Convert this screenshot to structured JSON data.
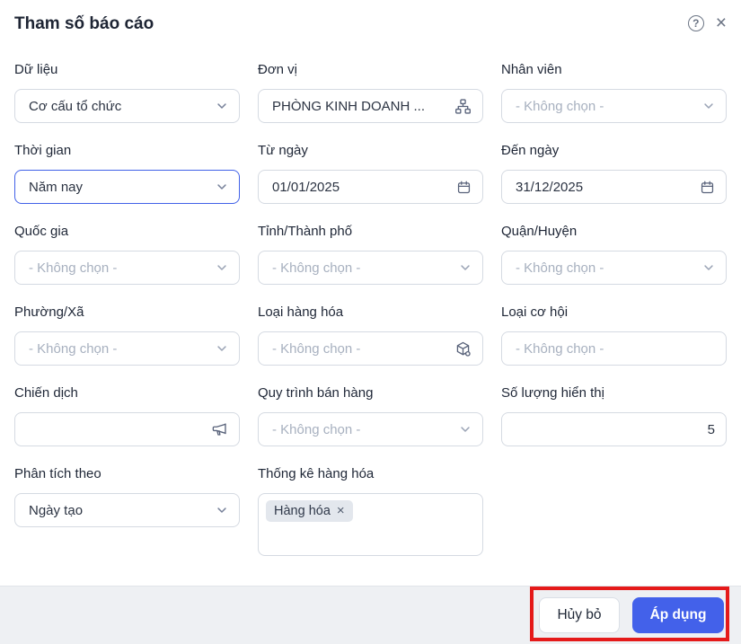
{
  "dialog": {
    "title": "Tham số báo cáo"
  },
  "fields": {
    "du_lieu": {
      "label": "Dữ liệu",
      "value": "Cơ cấu tổ chức"
    },
    "don_vi": {
      "label": "Đơn vị",
      "value": "PHÒNG KINH DOANH ...",
      "icon": "org-sitemap-icon"
    },
    "nhan_vien": {
      "label": "Nhân viên",
      "placeholder": "- Không chọn -"
    },
    "thoi_gian": {
      "label": "Thời gian",
      "value": "Năm nay",
      "state": "focused"
    },
    "tu_ngay": {
      "label": "Từ ngày",
      "value": "01/01/2025",
      "icon": "calendar-icon"
    },
    "den_ngay": {
      "label": "Đến ngày",
      "value": "31/12/2025",
      "icon": "calendar-icon"
    },
    "quoc_gia": {
      "label": "Quốc gia",
      "placeholder": "- Không chọn -"
    },
    "tinh_thanh_pho": {
      "label": "Tỉnh/Thành phố",
      "placeholder": "- Không chọn -"
    },
    "quan_huyen": {
      "label": "Quận/Huyện",
      "placeholder": "- Không chọn -"
    },
    "phuong_xa": {
      "label": "Phường/Xã",
      "placeholder": "- Không chọn -"
    },
    "loai_hang_hoa": {
      "label": "Loại hàng hóa",
      "placeholder": "- Không chọn -",
      "icon": "cube-icon"
    },
    "loai_co_hoi": {
      "label": "Loại cơ hội",
      "placeholder": "- Không chọn -"
    },
    "chien_dich": {
      "label": "Chiến dịch",
      "value": "",
      "icon": "megaphone-icon"
    },
    "quy_trinh_ban_hang": {
      "label": "Quy trình bán hàng",
      "placeholder": "- Không chọn -"
    },
    "so_luong_hien_thi": {
      "label": "Số lượng hiển thị",
      "value": "5"
    },
    "phan_tich_theo": {
      "label": "Phân tích theo",
      "value": "Ngày tạo"
    },
    "thong_ke_hang_hoa": {
      "label": "Thống kê hàng hóa",
      "tags": [
        {
          "label": "Hàng hóa",
          "remove_glyph": "×"
        }
      ]
    }
  },
  "header_icons": {
    "help_glyph": "?",
    "close_glyph": "×"
  },
  "footer": {
    "cancel_label": "Hủy bỏ",
    "apply_label": "Áp dụng"
  },
  "colors": {
    "accent_blue": "#4361ea",
    "focus_border": "#4161e8",
    "annotation_red": "#e51a1a",
    "footer_bg": "#eef0f3",
    "field_border": "#d5dae2",
    "placeholder_text": "#a7b0bf"
  },
  "annotation": {
    "type": "red-highlight-box",
    "target": "footer-buttons"
  }
}
